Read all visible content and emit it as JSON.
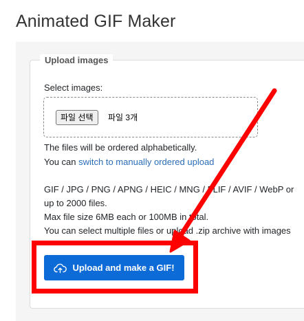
{
  "page": {
    "title": "Animated GIF Maker"
  },
  "upload_form": {
    "legend": "Upload images",
    "select_label": "Select images:",
    "file_input": {
      "button_label": "파일 선택",
      "selected_text": "파일 3개"
    },
    "order_note": "The files will be ordered alphabetically.",
    "manual_order": {
      "prefix": "You can ",
      "link_text": "switch to manually ordered upload"
    },
    "formats_line": "GIF / JPG / PNG / APNG / HEIC / MNG / FLIF / AVIF / WebP or",
    "limit_files": "up to 2000 files.",
    "limit_size": "Max file size 6MB each or 100MB in total.",
    "zip_note": "You can select multiple files or upload .zip archive with images",
    "submit_label": "Upload and make a GIF!"
  },
  "annotations": {
    "highlight_color": "#ff0000",
    "arrow_color": "#ff0000"
  },
  "icons": {
    "submit_icon": "cloud-upload-icon"
  }
}
